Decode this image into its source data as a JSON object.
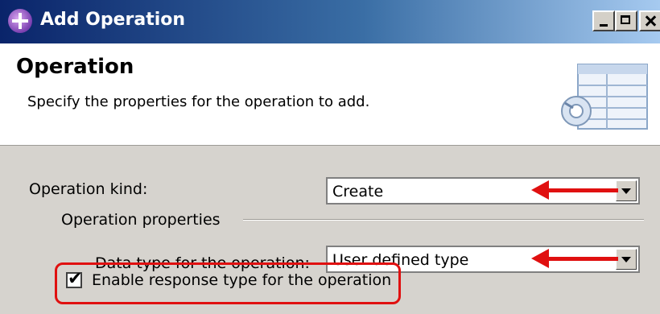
{
  "window": {
    "title": "Add Operation",
    "buttons": [
      "minimize",
      "maximize",
      "close"
    ]
  },
  "header": {
    "title": "Operation",
    "description": "Specify the properties for the operation to add."
  },
  "form": {
    "operation_kind_label": "Operation kind:",
    "operation_kind_value": "Create",
    "group_label": "Operation properties",
    "data_type_label": "Data type for the operation:",
    "data_type_value": "User defined type",
    "enable_response_label": "Enable response type for the operation",
    "enable_response_checked": true
  },
  "annotations": {
    "arrow_color": "#e01010",
    "highlight_color": "#e01010"
  }
}
